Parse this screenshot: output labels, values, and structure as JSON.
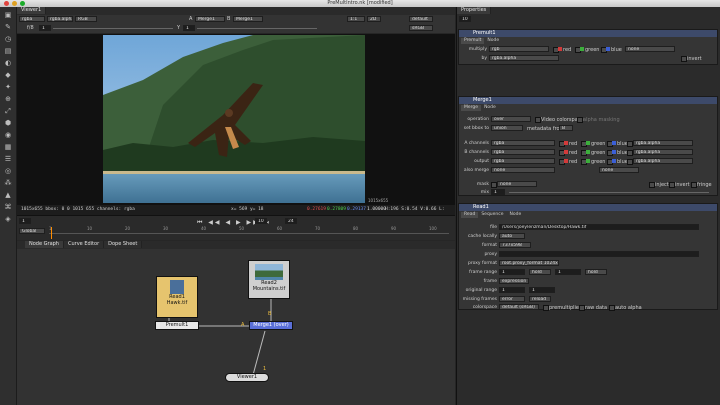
{
  "window": {
    "title": "PreMultIntro.nk [modified]"
  },
  "viewer": {
    "tab": "Viewer1",
    "channel_set": "rgba",
    "alpha_channel": "rgba.alpha",
    "display": "RGB",
    "input_a": "A",
    "input_a_node": "Merge1",
    "input_b": "B",
    "input_b_node": "Merge1",
    "zoom": "1:1",
    "mode": "2D",
    "lut": "default",
    "colorspace": "sRGB",
    "gain_label": "f/8",
    "gain_value": "1",
    "gamma_label": "Y",
    "gamma_value": "1",
    "frame_field": "1",
    "resolution_label": "1015x655",
    "info_left": "1015x655 bbox: 0 0 1015 655 channels: rgba",
    "info_xy": "x= 569 y= 18",
    "info_r": "0.27619",
    "info_g": "0.27809",
    "info_b": "0.29137",
    "info_a": "1.00000",
    "info_hsv": "H:196 S:0.54 V:0.66  L: 0.24394"
  },
  "timeline": {
    "frame": "1",
    "fps": "24",
    "increment": "10",
    "range_mode": "Global",
    "end_frame": "100",
    "ticks": [
      "1",
      "10",
      "20",
      "30",
      "40",
      "50",
      "60",
      "70",
      "80",
      "90",
      "100"
    ]
  },
  "graph": {
    "tabs": [
      "Node Graph",
      "Curve Editor",
      "Dope Sheet"
    ],
    "nodes": {
      "read1": "Read1\nHawk.tif",
      "read2": "Read2\nMountains.tif",
      "premult": "Premult1",
      "merge": "Merge1 (over)",
      "viewer": "Viewer1",
      "input_a": "A",
      "input_b": "B",
      "viewer_input": "1"
    }
  },
  "properties": {
    "tab": "Properties",
    "max_panels": "10",
    "premult": {
      "title": "Premult1",
      "tabs": [
        "Premult",
        "Node"
      ],
      "multiply_label": "multiply",
      "multiply": "rgb",
      "by_label": "by",
      "by": "rgba.alpha",
      "red": "red",
      "green": "green",
      "blue": "blue",
      "none": "none",
      "invert": "invert"
    },
    "merge": {
      "title": "Merge1",
      "tabs": [
        "Merge",
        "Node"
      ],
      "operation_label": "operation",
      "operation": "over",
      "video_colorspace": "Video colorspace",
      "alpha_masking": "alpha masking",
      "bbox_label": "set bbox to",
      "bbox": "union",
      "metadata_label": "metadata from",
      "metadata": "B",
      "a_label": "A channels",
      "a": "rgba",
      "b_label": "B channels",
      "b": "rgba",
      "output_label": "output",
      "output": "rgba",
      "also_label": "also merge",
      "also": "none",
      "also2": "none",
      "alpha": "rgba.alpha",
      "red": "red",
      "green": "green",
      "blue": "blue",
      "mask_label": "mask",
      "mask": "none",
      "inject": "inject",
      "invert": "invert",
      "fringe": "fringe",
      "mix_label": "mix",
      "mix": "1"
    },
    "read": {
      "title": "Read1",
      "tabs": [
        "Read",
        "Sequence",
        "Node"
      ],
      "file_label": "file",
      "file": "/Users/joeylenzman/Desktop/Hawk.tif",
      "cache_label": "cache locally",
      "cache": "auto",
      "format_label": "format",
      "format": "737x598",
      "proxy_label": "proxy",
      "proxy": "",
      "proxy_format_label": "proxy format",
      "proxy_format": "root.proxy_format 1024x778",
      "frame_range_label": "frame range",
      "frame_start": "1",
      "hold1": "hold",
      "frame_end": "1",
      "hold2": "hold",
      "frame_label": "frame",
      "frame": "expression",
      "original_label": "original range",
      "orig_start": "1",
      "orig_end": "1",
      "missing_label": "missing frames",
      "missing": "error",
      "reload": "reload",
      "colorspace_label": "colorspace",
      "colorspace": "default (sRGB)",
      "premultiplied": "premultiplied",
      "raw": "raw data",
      "auto_alpha": "auto alpha"
    }
  },
  "colors": {
    "accent": "#3d4a6a",
    "read_node": "#e6c46e",
    "merge_node": "#5a6fd8",
    "red": "#d23a3a",
    "green": "#3cae3c",
    "blue": "#3b5fd6"
  }
}
